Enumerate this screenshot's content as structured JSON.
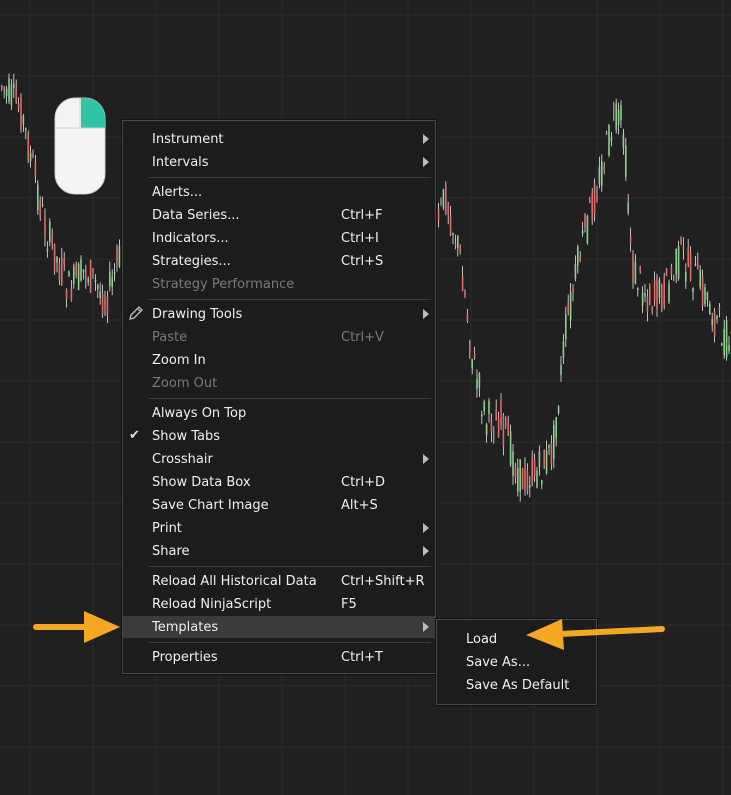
{
  "colors": {
    "background": "#202020",
    "grid": "#2b2b2b",
    "candle_up": "#8fd08f",
    "candle_down": "#e06b6b",
    "wick": "#e8e8e8",
    "arrow": "#f5a623",
    "mouse_accent": "#2fc4a6"
  },
  "icons": {
    "mouse": "mouse-right-click-icon",
    "pencil": "pencil-icon",
    "check": "check-icon",
    "submenu": "chevron-right-icon"
  },
  "context_menu": {
    "items": [
      {
        "label": "Instrument",
        "shortcut": "",
        "submenu": true
      },
      {
        "label": "Intervals",
        "shortcut": "",
        "submenu": true
      },
      {
        "label": "Alerts...",
        "shortcut": ""
      },
      {
        "label": "Data Series...",
        "shortcut": "Ctrl+F"
      },
      {
        "label": "Indicators...",
        "shortcut": "Ctrl+I"
      },
      {
        "label": "Strategies...",
        "shortcut": "Ctrl+S"
      },
      {
        "label": "Strategy Performance",
        "shortcut": "",
        "disabled": true
      },
      {
        "label": "Drawing Tools",
        "shortcut": "",
        "submenu": true
      },
      {
        "label": "Paste",
        "shortcut": "Ctrl+V",
        "disabled": true
      },
      {
        "label": "Zoom In",
        "shortcut": ""
      },
      {
        "label": "Zoom Out",
        "shortcut": "",
        "disabled": true
      },
      {
        "label": "Always On Top",
        "shortcut": ""
      },
      {
        "label": "Show Tabs",
        "shortcut": "",
        "checked": true
      },
      {
        "label": "Crosshair",
        "shortcut": "",
        "submenu": true
      },
      {
        "label": "Show Data Box",
        "shortcut": "Ctrl+D"
      },
      {
        "label": "Save Chart Image",
        "shortcut": "Alt+S"
      },
      {
        "label": "Print",
        "shortcut": "",
        "submenu": true
      },
      {
        "label": "Share",
        "shortcut": "",
        "submenu": true
      },
      {
        "label": "Reload All Historical Data",
        "shortcut": "Ctrl+Shift+R"
      },
      {
        "label": "Reload NinjaScript",
        "shortcut": "F5"
      },
      {
        "label": "Templates",
        "shortcut": "",
        "submenu": true,
        "highlighted": true
      },
      {
        "label": "Properties",
        "shortcut": "Ctrl+T"
      }
    ]
  },
  "templates_submenu": {
    "items": [
      {
        "label": "Load"
      },
      {
        "label": "Save As..."
      },
      {
        "label": "Save As Default"
      }
    ]
  }
}
